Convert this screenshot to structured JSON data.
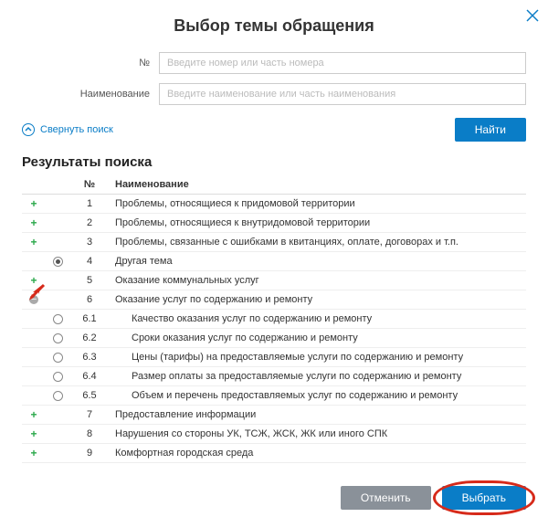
{
  "modal": {
    "title": "Выбор темы обращения"
  },
  "form": {
    "number_label": "№",
    "number_placeholder": "Введите номер или часть номера",
    "name_label": "Наименование",
    "name_placeholder": "Введите наименование или часть наименования"
  },
  "controls": {
    "collapse_label": "Свернуть поиск",
    "find_label": "Найти"
  },
  "results": {
    "title": "Результаты поиска",
    "columns": {
      "num": "№",
      "name": "Наименование"
    },
    "row1": {
      "num": "1",
      "name": "Проблемы, относящиеся к придомовой территории"
    },
    "row2": {
      "num": "2",
      "name": "Проблемы, относящиеся к внутридомовой территории"
    },
    "row3": {
      "num": "3",
      "name": "Проблемы, связанные с ошибками в квитанциях, оплате, договорах и т.п."
    },
    "row4": {
      "num": "4",
      "name": "Другая тема"
    },
    "row5": {
      "num": "5",
      "name": "Оказание коммунальных услуг"
    },
    "row6": {
      "num": "6",
      "name": "Оказание услуг по содержанию и ремонту"
    },
    "row6_1": {
      "num": "6.1",
      "name": "Качество оказания услуг по содержанию и ремонту"
    },
    "row6_2": {
      "num": "6.2",
      "name": "Сроки оказания услуг по содержанию и ремонту"
    },
    "row6_3": {
      "num": "6.3",
      "name": "Цены (тарифы) на предоставляемые услуги по содержанию и ремонту"
    },
    "row6_4": {
      "num": "6.4",
      "name": "Размер оплаты за предоставляемые услуги по содержанию и ремонту"
    },
    "row6_5": {
      "num": "6.5",
      "name": "Объем и перечень предоставляемых услуг по содержанию и ремонту"
    },
    "row7": {
      "num": "7",
      "name": "Предоставление информации"
    },
    "row8": {
      "num": "8",
      "name": "Нарушения со стороны УК, ТСЖ, ЖСК, ЖК или иного СПК"
    },
    "row9": {
      "num": "9",
      "name": "Комфортная городская среда"
    }
  },
  "footer": {
    "cancel_label": "Отменить",
    "select_label": "Выбрать"
  }
}
